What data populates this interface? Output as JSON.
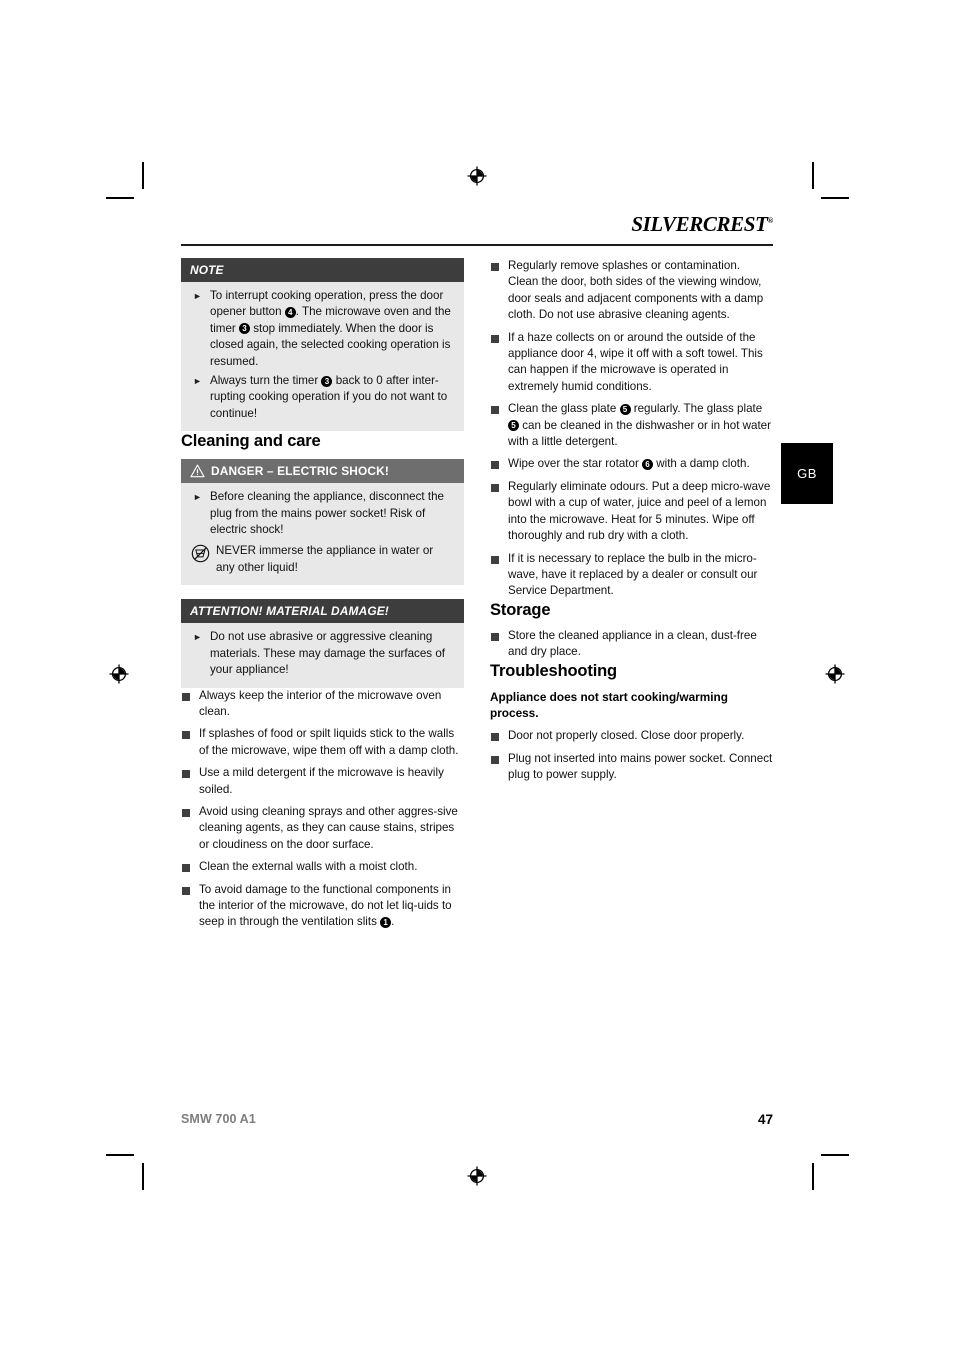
{
  "brand": {
    "name_light": "SILVER",
    "name_bold": "CREST",
    "registered": "®"
  },
  "language_tab": {
    "label": "GB"
  },
  "left_column": {
    "note_box": {
      "heading": "NOTE",
      "items": [
        {
          "parts": [
            {
              "t": "text",
              "v": "To interrupt cooking operation, press the door opener button "
            },
            {
              "t": "cnum",
              "v": "4"
            },
            {
              "t": "text",
              "v": ". The microwave oven and the timer "
            },
            {
              "t": "cnum",
              "v": "3"
            },
            {
              "t": "text",
              "v": " stop immediately. When the door is closed again, the selected cooking operation is resumed."
            }
          ]
        },
        {
          "parts": [
            {
              "t": "text",
              "v": "Always turn the timer "
            },
            {
              "t": "cnum",
              "v": "3"
            },
            {
              "t": "text",
              "v": " back to 0 after inter-rupting cooking operation if you do not want to continue!"
            }
          ]
        }
      ]
    },
    "cleaning_heading": "Cleaning and care",
    "danger_box": {
      "heading": "DANGER – ELECTRIC SHOCK!",
      "icon": "warning-triangle-icon",
      "items": [
        {
          "parts": [
            {
              "t": "text",
              "v": "Before cleaning the appliance, disconnect the plug from the mains power socket! Risk of electric shock!"
            }
          ]
        }
      ],
      "immersion_warning": {
        "icon": "no-immersion-icon",
        "text": "NEVER immerse the appliance in water or any other liquid!"
      }
    },
    "attention_box": {
      "heading": "ATTENTION! MATERIAL DAMAGE!",
      "items": [
        {
          "parts": [
            {
              "t": "text",
              "v": "Do not use abrasive or aggressive cleaning materials. These may damage the surfaces of your appliance!"
            }
          ]
        }
      ]
    },
    "bullets": [
      {
        "parts": [
          {
            "t": "text",
            "v": "Always keep the interior of the microwave oven clean."
          }
        ]
      },
      {
        "parts": [
          {
            "t": "text",
            "v": "If splashes of food or spilt liquids stick to the walls of the microwave, wipe them off with a damp cloth."
          }
        ]
      },
      {
        "parts": [
          {
            "t": "text",
            "v": "Use a mild detergent if the microwave is heavily soiled."
          }
        ]
      },
      {
        "parts": [
          {
            "t": "text",
            "v": "Avoid using cleaning sprays and other aggres-sive cleaning agents, as they can cause stains, stripes or cloudiness on the door surface."
          }
        ]
      },
      {
        "parts": [
          {
            "t": "text",
            "v": "Clean the external walls with a moist cloth."
          }
        ]
      },
      {
        "parts": [
          {
            "t": "text",
            "v": "To avoid damage to the functional components in the interior of the microwave, do not let liq-uids to seep in through the ventilation slits "
          },
          {
            "t": "cnum",
            "v": "1"
          },
          {
            "t": "text",
            "v": "."
          }
        ]
      }
    ]
  },
  "right_column": {
    "bullets": [
      {
        "parts": [
          {
            "t": "text",
            "v": "Regularly remove splashes or contamination. Clean the door, both sides of the viewing window, door seals and adjacent components with a damp cloth. Do not use abrasive cleaning agents."
          }
        ]
      },
      {
        "parts": [
          {
            "t": "text",
            "v": "If a haze collects on or around the outside of the appliance door 4, wipe it off with a soft towel. This can happen if the microwave is operated in extremely humid conditions."
          }
        ]
      },
      {
        "parts": [
          {
            "t": "text",
            "v": "Clean the glass plate "
          },
          {
            "t": "cnum",
            "v": "5"
          },
          {
            "t": "text",
            "v": " regularly. The glass plate "
          },
          {
            "t": "cnum",
            "v": "5"
          },
          {
            "t": "text",
            "v": " can be cleaned in the dishwasher or in hot water with a little detergent."
          }
        ]
      },
      {
        "parts": [
          {
            "t": "text",
            "v": "Wipe over the star rotator "
          },
          {
            "t": "cnum",
            "v": "6"
          },
          {
            "t": "text",
            "v": " with a damp cloth."
          }
        ]
      },
      {
        "parts": [
          {
            "t": "text",
            "v": "Regularly eliminate odours. Put a deep micro-wave bowl with a cup of water, juice and peel of a lemon into the microwave. Heat for 5 minutes. Wipe off thoroughly and rub dry with a cloth."
          }
        ]
      },
      {
        "parts": [
          {
            "t": "text",
            "v": "If it is necessary to replace the bulb in the micro-wave, have it replaced by a dealer or consult our Service Department."
          }
        ]
      }
    ],
    "storage_heading": "Storage",
    "storage_bullets": [
      {
        "parts": [
          {
            "t": "text",
            "v": "Store the cleaned appliance in a clean, dust-free and dry place."
          }
        ]
      }
    ],
    "troubleshooting_heading": "Troubleshooting",
    "troubleshooting_subheading": "Appliance does not start cooking/warming process.",
    "troubleshooting_bullets": [
      {
        "parts": [
          {
            "t": "text",
            "v": "Door not properly closed. Close door properly."
          }
        ]
      },
      {
        "parts": [
          {
            "t": "text",
            "v": "Plug not inserted into mains power socket. Connect plug to power supply."
          }
        ]
      }
    ]
  },
  "footer": {
    "model": "SMW 700 A1",
    "page_number": "47"
  },
  "colors": {
    "callout_header_dark": "#3d3d3d",
    "callout_header_gray": "#6e6e6e",
    "callout_body": "#e8e8e8",
    "tab_background": "#000000",
    "footer_model": "#7d7d7d"
  }
}
